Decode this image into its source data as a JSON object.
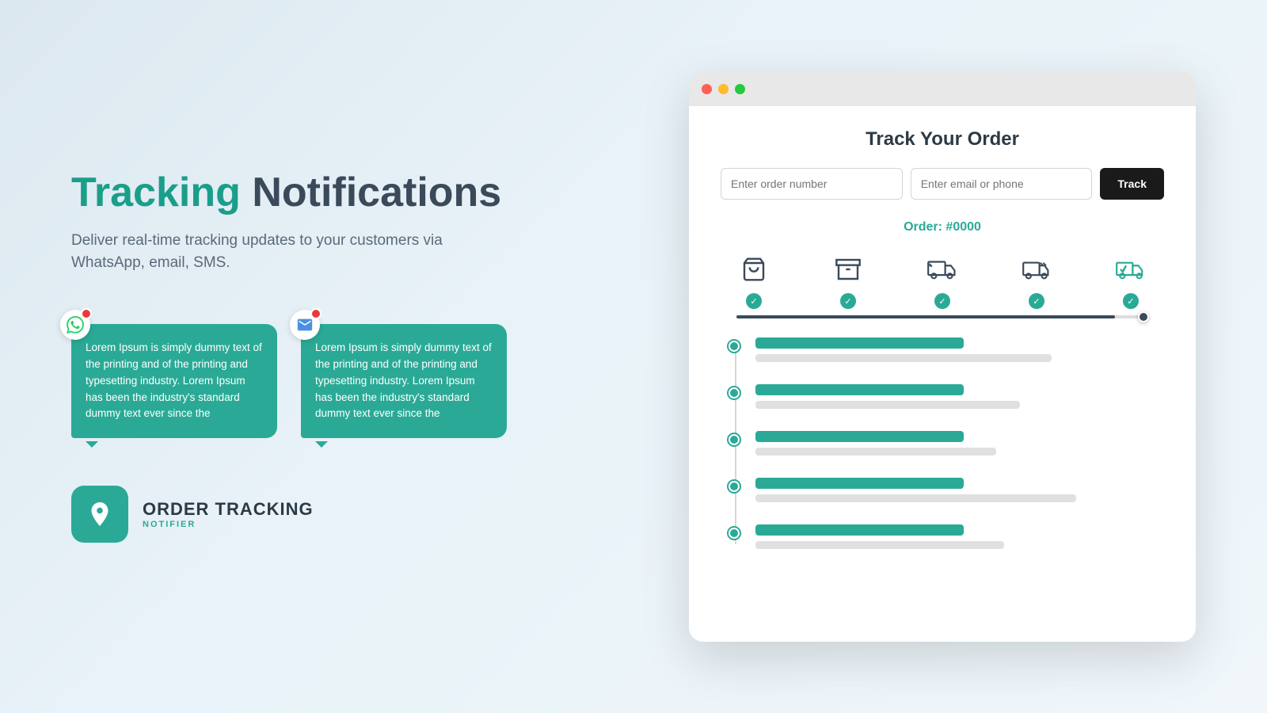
{
  "page": {
    "background": "gradient-light-blue"
  },
  "left": {
    "headline_highlight": "Tracking",
    "headline_rest": " Notifications",
    "subtitle": "Deliver real-time tracking updates to your customers via\nWhatsApp, email, SMS.",
    "bubble1": {
      "text": "Lorem Ipsum is simply dummy text of the printing and of the printing and typesetting industry. Lorem Ipsum has been the industry's standard dummy text ever since the",
      "icon": "whatsapp"
    },
    "bubble2": {
      "text": "Lorem Ipsum is simply dummy text of the printing and of the printing and typesetting industry. Lorem Ipsum has been the industry's standard dummy text ever since the",
      "icon": "email"
    },
    "brand_name": "ORDER TRACKING",
    "brand_sub": "NOTIFIER"
  },
  "browser": {
    "title": "Track Your Order",
    "input1_placeholder": "Enter order number",
    "input2_placeholder": "Enter email or phone",
    "track_btn": "Track",
    "order_number": "Order: #0000",
    "steps": [
      {
        "icon": "cart",
        "checked": true
      },
      {
        "icon": "box",
        "checked": true
      },
      {
        "icon": "truck-dispatch",
        "checked": true
      },
      {
        "icon": "truck-transit",
        "checked": true
      },
      {
        "icon": "truck-delivered",
        "checked": true
      }
    ],
    "timeline_items": [
      {
        "main_width": "55%",
        "sub_width": "75%"
      },
      {
        "main_width": "55%",
        "sub_width": "68%"
      },
      {
        "main_width": "55%",
        "sub_width": "62%"
      },
      {
        "main_width": "55%",
        "sub_width": "78%"
      },
      {
        "main_width": "55%",
        "sub_width": "65%"
      }
    ]
  }
}
